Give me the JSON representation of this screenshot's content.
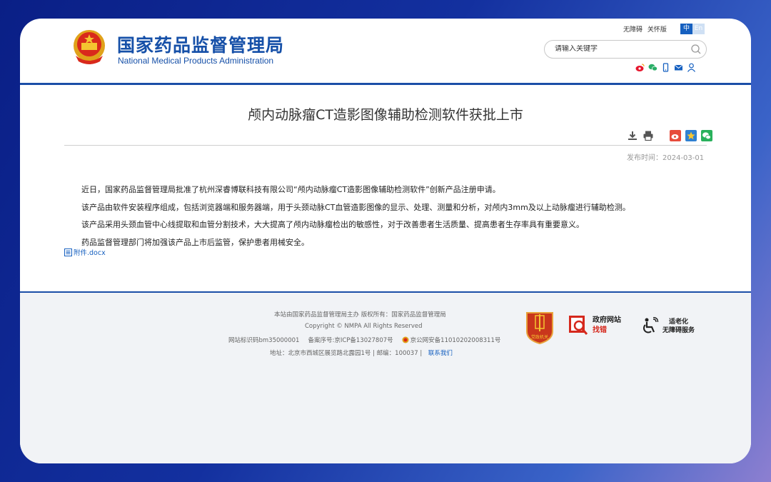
{
  "header": {
    "title_cn": "国家药品监督管理局",
    "title_en": "National Medical Products Administration",
    "toplinks": [
      "无障碍",
      "关怀版"
    ],
    "lang": [
      "中",
      "En"
    ],
    "search": {
      "placeholder": "请输入关键字"
    },
    "social_icons": [
      "weibo-icon",
      "wechat-icon",
      "mobile-icon",
      "mail-icon",
      "user-icon"
    ]
  },
  "article": {
    "title": "颅内动脉瘤CT造影图像辅助检测软件获批上市",
    "date": "发布时间：2024-03-01",
    "tools": [
      "download-icon",
      "print-icon",
      "share-weibo-icon",
      "share-qzone-icon",
      "share-wechat-icon"
    ],
    "paragraphs": [
      "近日，国家药品监督管理局批准了杭州深睿博联科技有限公司“颅内动脉瘤CT造影图像辅助检测软件”创新产品注册申请。",
      "该产品由软件安装程序组成，包括浏览器端和服务器端，用于头颈动脉CT血管造影图像的显示、处理、测量和分析，对颅内3mm及以上动脉瘤进行辅助检测。",
      "该产品采用头颈血管中心线提取和血管分割技术，大大提高了颅内动脉瘤检出的敏感性，对于改善患者生活质量、提高患者生存率具有重要意义。",
      "药品监督管理部门将加强该产品上市后监管，保护患者用械安全。"
    ],
    "attachment": "附件.docx"
  },
  "footer": {
    "line1": "本站由国家药品监督管理局主办 版权所有：国家药品监督管理局",
    "line2": "Copyright © NMPA All Rights Reserved",
    "line3_site": "网站标识码bm35000001",
    "line3_icp": "备案序号:京ICP备13027807号",
    "line3_police": "京公网安备11010202008311号",
    "line4": "地址：北京市西城区展览路北露园1号 | 邮编：100037 |",
    "contact": "联系我们",
    "badge_party": "党政机关",
    "badge_gov_top": "政府网站",
    "badge_gov_bottom": "找错",
    "badge_access_top": "适老化",
    "badge_access_bottom": "无障碍服务"
  },
  "colors": {
    "brand_blue": "#1650a8",
    "rule_blue": "#1b4ea7",
    "link_blue": "#1660c0"
  }
}
